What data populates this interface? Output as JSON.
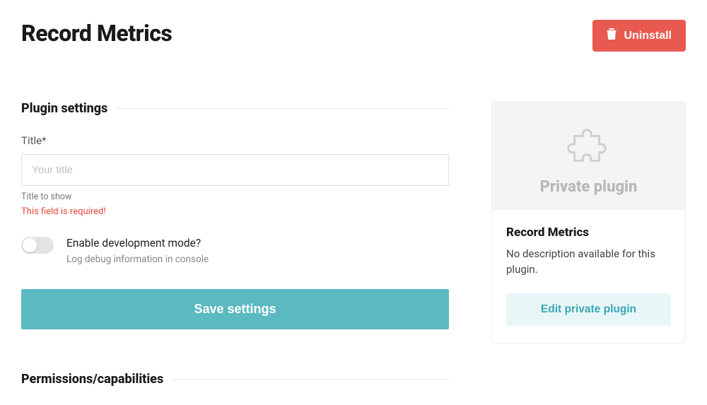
{
  "header": {
    "title": "Record Metrics",
    "uninstall_label": "Uninstall"
  },
  "settings_section": {
    "heading": "Plugin settings",
    "title_field": {
      "label": "Title*",
      "placeholder": "Your title",
      "value": "",
      "helper": "Title to show",
      "error": "This field is required!"
    },
    "dev_mode": {
      "label": "Enable development mode?",
      "help": "Log debug information in console",
      "enabled": false
    },
    "save_label": "Save settings"
  },
  "permissions_section": {
    "heading": "Permissions/capabilities"
  },
  "sidebar_card": {
    "badge": "Private plugin",
    "title": "Record Metrics",
    "description": "No description available for this plugin.",
    "edit_label": "Edit private plugin"
  }
}
